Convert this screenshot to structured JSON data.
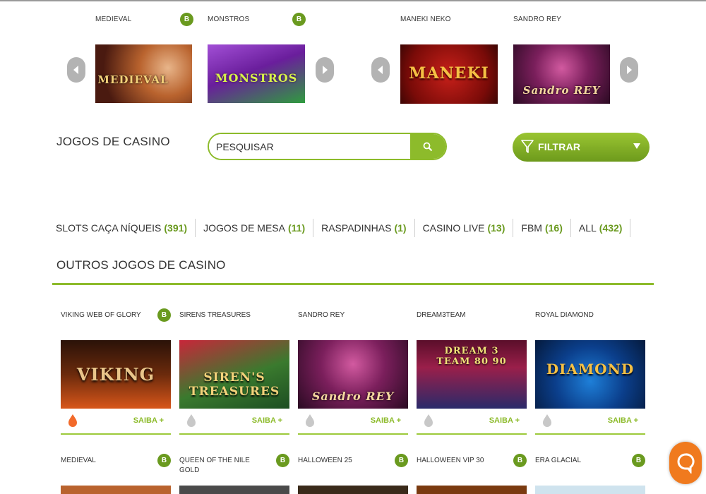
{
  "carousel": {
    "items": [
      {
        "title": "MEDIEVAL",
        "badge": "B",
        "art": "MEDIEVAL"
      },
      {
        "title": "MONSTROS",
        "badge": "B",
        "art": "MONSTROS"
      },
      {
        "title": "MANEKI NEKO",
        "badge": "",
        "art": "MANEKI"
      },
      {
        "title": "SANDRO REY",
        "badge": "",
        "art": "Sandro REY"
      }
    ]
  },
  "header": {
    "title": "JOGOS DE CASINO"
  },
  "search": {
    "placeholder": "PESQUISAR",
    "icon": "search-icon"
  },
  "filter": {
    "label": "FILTRAR",
    "icon": "funnel-icon"
  },
  "tabs": [
    {
      "label": "SLOTS CAÇA NÍQUEIS",
      "count": "(391)"
    },
    {
      "label": "JOGOS DE MESA",
      "count": "(11)"
    },
    {
      "label": "RASPADINHAS",
      "count": "(1)"
    },
    {
      "label": "CASINO LIVE",
      "count": "(13)"
    },
    {
      "label": "FBM",
      "count": "(16)"
    },
    {
      "label": "ALL",
      "count": "(432)"
    }
  ],
  "section": {
    "title": "OUTROS JOGOS DE CASINO"
  },
  "games_row1": [
    {
      "title": "VIKING WEB OF GLORY",
      "badge": "B",
      "art": "VIKING",
      "saiba": "SAIBA +",
      "hot": true
    },
    {
      "title": "SIRENS TREASURES",
      "badge": "",
      "art": "SIREN'S TREASURES",
      "saiba": "SAIBA +",
      "hot": false
    },
    {
      "title": "SANDRO REY",
      "badge": "",
      "art": "Sandro REY",
      "saiba": "SAIBA +",
      "hot": false
    },
    {
      "title": "DREAM3TEAM",
      "badge": "",
      "art": "DREAM 3 TEAM 80 90",
      "saiba": "SAIBA +",
      "hot": false
    },
    {
      "title": "ROYAL DIAMOND",
      "badge": "",
      "art": "DIAMOND",
      "saiba": "SAIBA +",
      "hot": false
    }
  ],
  "games_row2": [
    {
      "title": "MEDIEVAL",
      "badge": "B"
    },
    {
      "title": "QUEEN OF THE NILE GOLD",
      "badge": "B"
    },
    {
      "title": "HALLOWEEN 25",
      "badge": "B"
    },
    {
      "title": "HALLOWEEN VIP 30",
      "badge": "B"
    },
    {
      "title": "ERA GLACIAL",
      "badge": "B"
    }
  ],
  "colors": {
    "accent": "#8dbb2b",
    "accent_dark": "#6a9a1f",
    "chat": "#f07a1e"
  }
}
